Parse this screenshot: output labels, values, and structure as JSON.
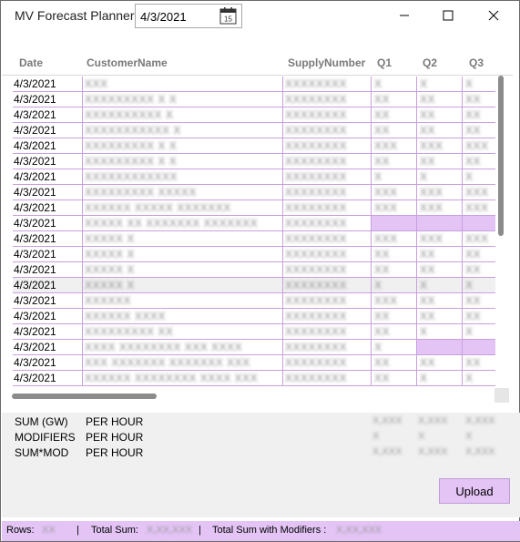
{
  "app": {
    "title": "MV Forecast Planner",
    "date_value": "4/3/2021",
    "calendar_day": "15"
  },
  "columns": [
    "Date",
    "CustomerName",
    "SupplyNumber",
    "Q1",
    "Q2",
    "Q3"
  ],
  "rows": [
    {
      "date": "4/3/2021",
      "customer": "XXX",
      "supply": "XXXXXXXX",
      "q1": "X",
      "q2": "X",
      "q3": "X"
    },
    {
      "date": "4/3/2021",
      "customer": "XXXXXXXXX X X",
      "supply": "XXXXXXXX",
      "q1": "XX",
      "q2": "XX",
      "q3": "XX"
    },
    {
      "date": "4/3/2021",
      "customer": "XXXXXXXXXX X",
      "supply": "XXXXXXXX",
      "q1": "XX",
      "q2": "XX",
      "q3": "XX"
    },
    {
      "date": "4/3/2021",
      "customer": "XXXXXXXXXXX X",
      "supply": "XXXXXXXX",
      "q1": "XX",
      "q2": "XX",
      "q3": "XX"
    },
    {
      "date": "4/3/2021",
      "customer": "XXXXXXXXX X X",
      "supply": "XXXXXXXX",
      "q1": "XXX",
      "q2": "XXX",
      "q3": "XXX"
    },
    {
      "date": "4/3/2021",
      "customer": "XXXXXXXXX X X",
      "supply": "XXXXXXXX",
      "q1": "XX",
      "q2": "XX",
      "q3": "XX"
    },
    {
      "date": "4/3/2021",
      "customer": "XXXXXXXXXXXX",
      "supply": "XXXXXXXX",
      "q1": "X",
      "q2": "X",
      "q3": "X"
    },
    {
      "date": "4/3/2021",
      "customer": "XXXXXXXXX XXXXX",
      "supply": "XXXXXXXX",
      "q1": "XXX",
      "q2": "XXX",
      "q3": "XXX"
    },
    {
      "date": "4/3/2021",
      "customer": "XXXXXX XXXXX XXXXXXX",
      "supply": "XXXXXXXX",
      "q1": "XXX",
      "q2": "XXX",
      "q3": "XXX"
    },
    {
      "date": "4/3/2021",
      "customer": "XXXXX XX XXXXXXX XXXXXXX",
      "supply": "XXXXXXXX",
      "q1": "",
      "q2": "",
      "q3": "",
      "hl_q": true
    },
    {
      "date": "4/3/2021",
      "customer": "XXXXX X",
      "supply": "XXXXXXXX",
      "q1": "XXX",
      "q2": "XXX",
      "q3": "XXX"
    },
    {
      "date": "4/3/2021",
      "customer": "XXXXX X",
      "supply": "XXXXXXXX",
      "q1": "XX",
      "q2": "XX",
      "q3": "XX"
    },
    {
      "date": "4/3/2021",
      "customer": "XXXXX X",
      "supply": "XXXXXXXX",
      "q1": "XX",
      "q2": "XX",
      "q3": "XX"
    },
    {
      "date": "4/3/2021",
      "customer": "XXXXX X",
      "supply": "XXXXXXXX",
      "q1": "X",
      "q2": "X",
      "q3": "X",
      "selected": true
    },
    {
      "date": "4/3/2021",
      "customer": "XXXXXX",
      "supply": "XXXXXXXX",
      "q1": "XXX",
      "q2": "XX",
      "q3": "XX"
    },
    {
      "date": "4/3/2021",
      "customer": "XXXXXX XXXX",
      "supply": "XXXXXXXX",
      "q1": "XX",
      "q2": "XX",
      "q3": "XX"
    },
    {
      "date": "4/3/2021",
      "customer": "XXXXXXXXX XX",
      "supply": "XXXXXXXX",
      "q1": "XX",
      "q2": "X",
      "q3": "X"
    },
    {
      "date": "4/3/2021",
      "customer": "XXXX XXXXXXXX XXX XXXX",
      "supply": "XXXXXXXX",
      "q1": "X",
      "q2": "",
      "q3": "",
      "hl_q23": true
    },
    {
      "date": "4/3/2021",
      "customer": "XXX XXXXXXX XXXXXXX XXX",
      "supply": "XXXXXXXX",
      "q1": "XX",
      "q2": "XX",
      "q3": "XX"
    },
    {
      "date": "4/3/2021",
      "customer": "XXXXXX XXXXXXXX XXXX XXX",
      "supply": "XXXXXXXX",
      "q1": "XX",
      "q2": "X",
      "q3": "X"
    }
  ],
  "summary": [
    {
      "label": "SUM (GW)",
      "per": "PER HOUR",
      "q1": "X,XXX",
      "q2": "X,XXX",
      "q3": "X,XXX"
    },
    {
      "label": "MODIFIERS",
      "per": "PER HOUR",
      "q1": "X",
      "q2": "X",
      "q3": "X"
    },
    {
      "label": "SUM*MOD",
      "per": "PER HOUR",
      "q1": "X,XXX",
      "q2": "X,XXX",
      "q3": "X,XXX"
    }
  ],
  "upload_label": "Upload",
  "status": {
    "rows_label": "Rows:",
    "rows_value": "XX",
    "sep": "|",
    "total_label": "Total Sum:",
    "total_value": "X,XX,XXX",
    "total_mod_label": "Total Sum with Modifiers :",
    "total_mod_value": "X,XX,XXX"
  },
  "colors": {
    "accent": "#e3c4f5",
    "grid_line": "#c8a0e0",
    "selected_row": "#f0f0f0"
  },
  "icons": {
    "calendar": "calendar-icon",
    "minimize": "minimize-icon",
    "maximize": "maximize-icon",
    "close": "close-icon"
  }
}
